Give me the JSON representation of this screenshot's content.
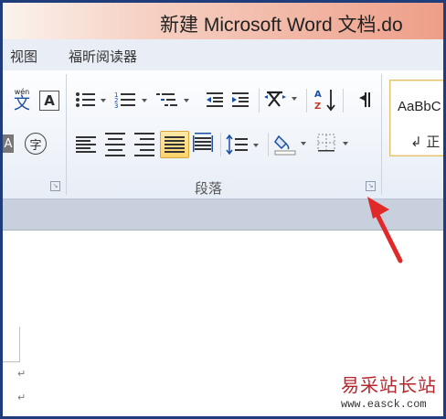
{
  "window": {
    "title": "新建 Microsoft Word 文档.do"
  },
  "tabs": [
    {
      "label": "视图"
    },
    {
      "label": "福昕阅读器"
    }
  ],
  "ribbon": {
    "font_group": {
      "wen_glyph": "文",
      "wen_pinyin": "wén",
      "boxed_a": "A",
      "circled_char": "字",
      "half_a": "A"
    },
    "paragraph_group": {
      "label": "段落"
    },
    "styles": {
      "preview": "AaBbC",
      "name": "↲ 正"
    }
  },
  "document": {
    "para_marks": [
      "↵",
      "↵"
    ]
  },
  "watermark": {
    "text": "易采站长站",
    "url": "www.easck.com"
  },
  "colors": {
    "accent": "#e02a2a",
    "title_gradient_end": "#ee9e88"
  }
}
